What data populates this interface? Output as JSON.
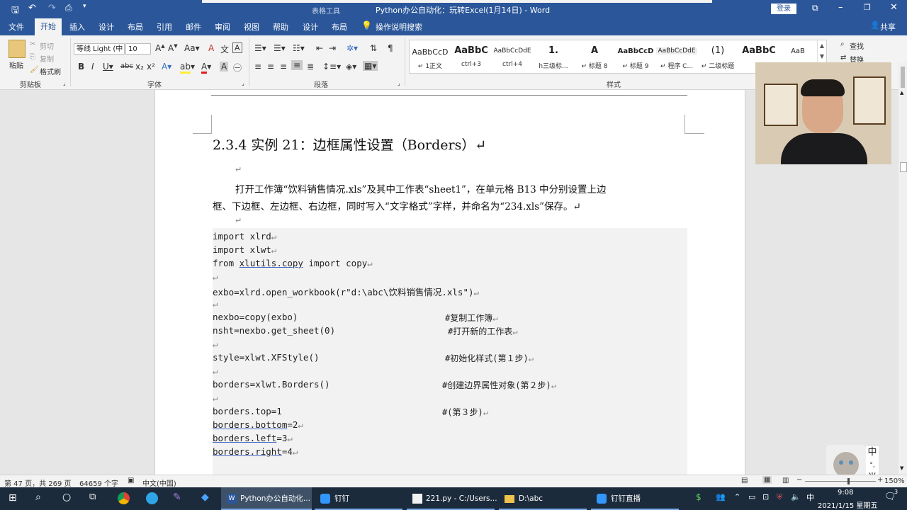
{
  "window": {
    "title": "Python办公自动化：玩转Excel(1月14日) - Word",
    "context_tab": "表格工具",
    "login": "登录",
    "share": "共享"
  },
  "tabs": [
    "文件",
    "开始",
    "插入",
    "设计",
    "布局",
    "引用",
    "邮件",
    "审阅",
    "视图",
    "帮助",
    "设计",
    "布局"
  ],
  "tell_me": "操作说明搜索",
  "ribbon": {
    "clipboard": {
      "paste": "粘贴",
      "cut": "剪切",
      "copy": "复制",
      "format_painter": "格式刷",
      "label": "剪贴板"
    },
    "font": {
      "name": "等线 Light (中",
      "size": "10",
      "label": "字体"
    },
    "paragraph": {
      "label": "段落"
    },
    "styles": {
      "label": "样式",
      "items": [
        {
          "preview": "AaBbCcD",
          "name": "↵ 1正文"
        },
        {
          "preview": "AaBbC",
          "name": "ctrl+3"
        },
        {
          "preview": "AaBbCcDdE",
          "name": "ctrl+4"
        },
        {
          "preview": "1.",
          "name": "h三级标..."
        },
        {
          "preview": "A",
          "name": "↵ 标题 8"
        },
        {
          "preview": "AaBbCcD",
          "name": "↵ 标题 9"
        },
        {
          "preview": "AaBbCcDdE",
          "name": "↵ 程序 C..."
        },
        {
          "preview": "(1)",
          "name": "↵ 二级标题"
        },
        {
          "preview": "AaBbC",
          "name": ""
        },
        {
          "preview": "AaB",
          "name": ""
        }
      ]
    },
    "editing": {
      "find": "查找",
      "replace": "替换"
    }
  },
  "document": {
    "heading": "2.3.4 实例 21：边框属性设置（Borders）↵",
    "return_mark": "↵",
    "para_line1": "打开工作簿“饮料销售情况.xls”及其中工作表“sheet1”，在单元格 B13 中分别设置上边",
    "para_line2": "框、下边框、左边框、右边框，同时写入“文字格式”字样，并命名为“234.xls”保存。↵",
    "code": [
      {
        "text": "import xlrd",
        "comment": ""
      },
      {
        "text": "import xlwt",
        "comment": ""
      },
      {
        "text_a": "from ",
        "link": "xlutils.copy",
        "text_b": " import copy",
        "comment": ""
      },
      {
        "text": "",
        "comment": ""
      },
      {
        "text": "exbo=xlrd.open_workbook(r\"d:\\abc\\饮料销售情况.xls\")",
        "comment": ""
      },
      {
        "text": "",
        "comment": ""
      },
      {
        "text": "nexbo=copy(exbo)",
        "comment": "#复制工作簿"
      },
      {
        "text": "nsht=nexbo.get_sheet(0)",
        "comment": "#打开新的工作表"
      },
      {
        "text": "",
        "comment": ""
      },
      {
        "text": "style=xlwt.XFStyle()",
        "comment": "#初始化样式(第１步)"
      },
      {
        "text": "",
        "comment": ""
      },
      {
        "text": "borders=xlwt.Borders()",
        "comment": "#创建边界属性对象(第２步)"
      },
      {
        "text": "",
        "comment": ""
      },
      {
        "text": "borders.top=1",
        "comment": "#(第３步)"
      },
      {
        "link": "borders.bottom",
        "text_b": "=2",
        "comment": ""
      },
      {
        "link": "borders.left",
        "text_b": "=3",
        "comment": ""
      },
      {
        "link": "borders.right",
        "text_b": "=4",
        "comment": ""
      }
    ]
  },
  "status": {
    "page": "第 47 页，共 269 页",
    "words": "64659 个字",
    "language": "中文(中国)",
    "zoom": "150%"
  },
  "taskbar": {
    "apps": [
      {
        "label": "Python办公自动化..."
      },
      {
        "label": "钉钉"
      },
      {
        "label": "221.py - C:/Users..."
      },
      {
        "label": "D:\\abc"
      },
      {
        "label": "钉钉直播"
      }
    ],
    "time": "9:08",
    "date": "2021/1/15 星期五",
    "ime": [
      "中",
      "°,",
      "半"
    ]
  }
}
